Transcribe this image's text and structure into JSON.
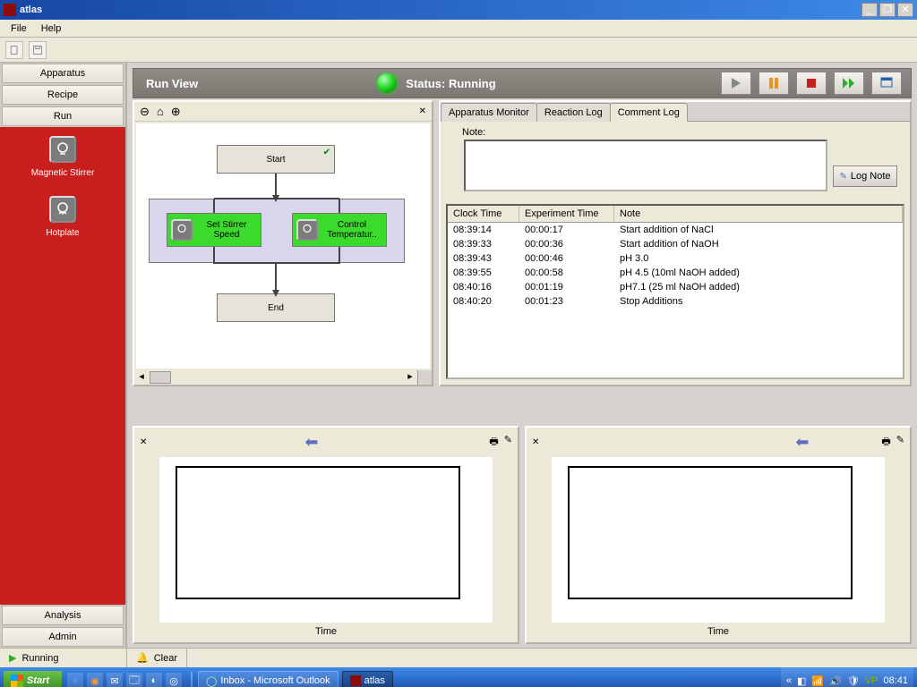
{
  "window": {
    "title": "atlas"
  },
  "menu": {
    "file": "File",
    "help": "Help"
  },
  "sidebar": {
    "top": [
      "Apparatus",
      "Recipe",
      "Run"
    ],
    "dev1": "Magnetic Stirrer",
    "dev2": "Hotplate",
    "bottom": [
      "Analysis",
      "Admin"
    ]
  },
  "runbar": {
    "title": "Run View",
    "status_label": "Status: Running"
  },
  "flow": {
    "start": "Start",
    "end": "End",
    "stir": "Set Stirrer Speed",
    "temp": "Control Temperatur.."
  },
  "tabs": {
    "t1": "Apparatus Monitor",
    "t2": "Reaction Log",
    "t3": "Comment Log"
  },
  "note": {
    "label": "Note:",
    "btn": "Log Note"
  },
  "table": {
    "h1": "Clock Time",
    "h2": "Experiment Time",
    "h3": "Note",
    "rows": [
      {
        "c": "08:39:14",
        "e": "00:00:17",
        "n": "Start addition of NaCl"
      },
      {
        "c": "08:39:33",
        "e": "00:00:36",
        "n": "Start addition of NaOH"
      },
      {
        "c": "08:39:43",
        "e": "00:00:46",
        "n": "pH 3.0"
      },
      {
        "c": "08:39:55",
        "e": "00:00:58",
        "n": "pH 4.5 (10ml NaOH added)"
      },
      {
        "c": "08:40:16",
        "e": "00:01:19",
        "n": "pH7.1 (25 ml NaOH added)"
      },
      {
        "c": "08:40:20",
        "e": "00:01:23",
        "n": "Stop Additions"
      }
    ]
  },
  "chartlabel": "Time",
  "status": {
    "running": "Running",
    "clear": "Clear"
  },
  "taskbar": {
    "start": "Start",
    "outlook": "Inbox - Microsoft Outlook",
    "app": "atlas",
    "clock": "08:41"
  }
}
